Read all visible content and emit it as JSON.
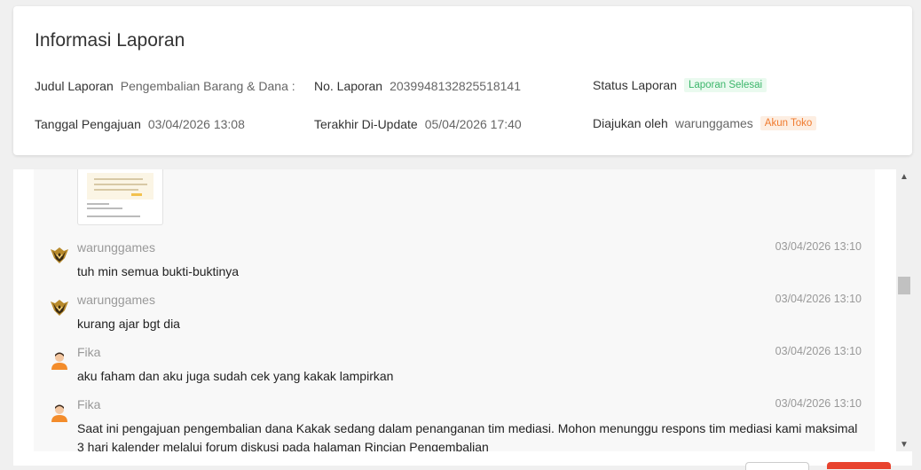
{
  "info": {
    "title": "Informasi Laporan",
    "judul_label": "Judul Laporan",
    "judul_value": "Pengembalian Barang & Dana :",
    "no_label": "No. Laporan",
    "no_value": "2039948132825518141",
    "status_label": "Status Laporan",
    "status_value": "Laporan Selesai",
    "tanggal_label": "Tanggal Pengajuan",
    "tanggal_value": "03/04/2026 13:08",
    "update_label": "Terakhir Di-Update",
    "update_value": "05/04/2026 17:40",
    "diajukan_label": "Diajukan oleh",
    "diajukan_value": "warunggames",
    "diajukan_badge": "Akun Toko"
  },
  "messages": [
    {
      "sender": "warunggames",
      "time": "03/04/2026 13:10",
      "text": "tuh min semua bukti-buktinya",
      "avatar": "shop-logo-icon"
    },
    {
      "sender": "warunggames",
      "time": "03/04/2026 13:10",
      "text": "kurang ajar bgt dia",
      "avatar": "shop-logo-icon"
    },
    {
      "sender": "Fika",
      "time": "03/04/2026 13:10",
      "text": "aku faham dan aku juga sudah cek yang kakak lampirkan",
      "avatar": "agent-avatar-icon"
    },
    {
      "sender": "Fika",
      "time": "03/04/2026 13:10",
      "text": "Saat ini pengajuan pengembalian dana Kakak sedang dalam penanganan tim mediasi. Mohon menunggu respons tim mediasi kami maksimal 3 hari kalender melalui forum diskusi pada halaman Rincian Pengembalian",
      "avatar": "agent-avatar-icon"
    }
  ],
  "colors": {
    "status_green": "#3cb66b",
    "badge_orange": "#f07a2d",
    "primary_red": "#e8432e"
  }
}
